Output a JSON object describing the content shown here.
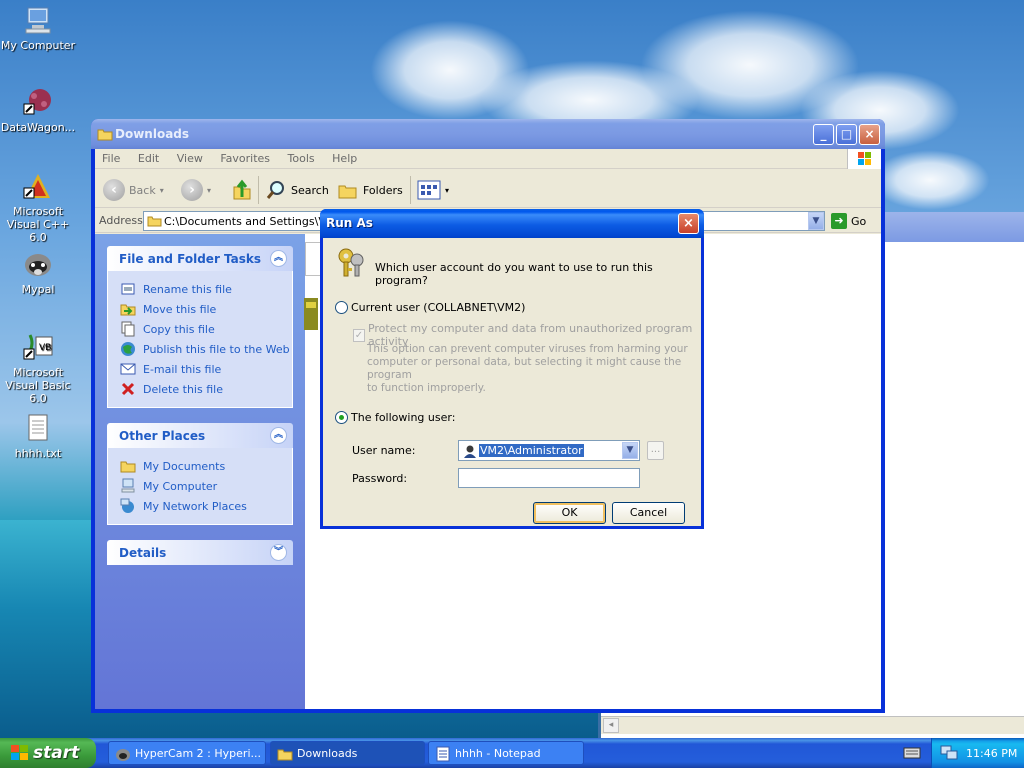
{
  "desktop": {
    "icons": [
      {
        "label": "My Computer",
        "icon": "my-computer-icon"
      },
      {
        "label": "DataWagon...",
        "icon": "datawagon-icon"
      },
      {
        "label": "Microsoft Visual C++ 6.0",
        "icon": "visual-cpp-icon"
      },
      {
        "label": "Mypal",
        "icon": "mypal-icon"
      },
      {
        "label": "Microsoft Visual Basic 6.0",
        "icon": "visual-basic-icon"
      },
      {
        "label": "hhhh.txt",
        "icon": "text-file-icon"
      }
    ]
  },
  "explorer": {
    "title": "Downloads",
    "menu": [
      "File",
      "Edit",
      "View",
      "Favorites",
      "Tools",
      "Help"
    ],
    "toolbar": {
      "back": "Back",
      "search": "Search",
      "folders": "Folders"
    },
    "address": {
      "label": "Address",
      "value": "C:\\Documents and Settings\\VM2",
      "go": "Go"
    },
    "file_tasks": {
      "title": "File and Folder Tasks",
      "items": [
        "Rename this file",
        "Move this file",
        "Copy this file",
        "Publish this file to the Web",
        "E-mail this file",
        "Delete this file"
      ]
    },
    "other_places": {
      "title": "Other Places",
      "items": [
        "My Documents",
        "My Computer",
        "My Network Places"
      ]
    },
    "details": {
      "title": "Details"
    }
  },
  "runas": {
    "title": "Run As",
    "question": "Which user account do you want to use to run this program?",
    "current_user": "Current user (COLLABNET\\VM2)",
    "protect": "Protect my computer and data from unauthorized program activity",
    "protect_note": [
      "This option can prevent computer viruses from harming your",
      "computer or personal data, but selecting it might cause the program",
      "to function improperly."
    ],
    "following_user": "The following user:",
    "username_label": "User name:",
    "username_value": "VM2\\Administrator",
    "password_label": "Password:",
    "password_value": "",
    "browse": "...",
    "ok": "OK",
    "cancel": "Cancel"
  },
  "taskbar": {
    "start": "start",
    "tasks": [
      "HyperCam 2 : Hyperi...",
      "Downloads",
      "hhhh - Notepad"
    ],
    "clock": "11:46 PM"
  },
  "colors": {
    "xp_blue": "#0831d9",
    "task_link": "#215dc6",
    "start_green": "#3a9a3a"
  }
}
